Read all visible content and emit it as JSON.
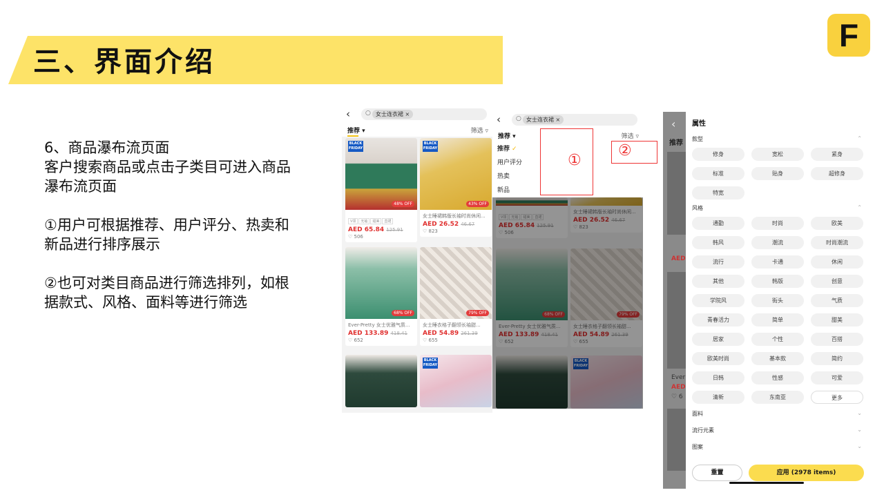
{
  "slide": {
    "title": "三、界面介绍",
    "logo_letter": "F",
    "desc": [
      [
        "6、商品瀑布流页面",
        "客户搜索商品或点击子类目可进入商品",
        "瀑布流页面"
      ],
      [
        "①用户可根据推荐、用户评分、热卖和",
        "新品进行排序展示"
      ],
      [
        "②也可对类目商品进行筛选排列，如根",
        "据款式、风格、面料等进行筛选"
      ]
    ]
  },
  "app": {
    "search_chip": "女士连衣裙 ×",
    "sort_label": "推荐 ▾",
    "filter_label": "筛选 ▿",
    "products": [
      {
        "badge": "BLACK FRIDAY",
        "off": "48% OFF",
        "tags": [
          "V领",
          "无袖",
          "甜美",
          "直裙"
        ],
        "price": "AED 65.84",
        "orig": "125.91",
        "likes": "♡ 506"
      },
      {
        "badge": "BLACK FRIDAY",
        "off": "43% OFF",
        "name": "女士睡裙韩版长袖时尚休闲...",
        "price": "AED 26.52",
        "orig": "46.67",
        "likes": "♡ 823"
      },
      {
        "off": "68% OFF",
        "name": "Ever-Pretty 女士优雅气质...",
        "price": "AED 133.89",
        "orig": "418.41",
        "likes": "♡ 652"
      },
      {
        "off": "79% OFF",
        "name": "女士睡衣格子翻领长袖甜...",
        "price": "AED 54.89",
        "orig": "261.39",
        "likes": "♡ 655"
      },
      {},
      {
        "badge": "BLACK FRIDAY"
      }
    ],
    "sort_menu": [
      "推荐",
      "用户评分",
      "热卖",
      "新品"
    ],
    "check": "✓",
    "markers": [
      "①",
      "②"
    ],
    "filter_panel": {
      "title": "属性",
      "sections": [
        {
          "name": "款型",
          "chevron": "⌃",
          "options": [
            "修身",
            "宽松",
            "紧身",
            "标准",
            "贴身",
            "超修身",
            "特宽"
          ]
        },
        {
          "name": "风格",
          "chevron": "⌃",
          "options": [
            "通勤",
            "时尚",
            "欧美",
            "韩风",
            "潮流",
            "时尚潮流",
            "流行",
            "卡通",
            "休闲",
            "其他",
            "韩版",
            "创意",
            "学院风",
            "街头",
            "气质",
            "青春活力",
            "简单",
            "甜美",
            "居家",
            "个性",
            "百搭",
            "欧美时尚",
            "基本款",
            "简约",
            "日韩",
            "性感",
            "可爱",
            "清新",
            "东南亚",
            "更多"
          ]
        }
      ],
      "collapsed": [
        "面料",
        "流行元素",
        "图案"
      ],
      "collapsed_chevron": "⌄",
      "reset_label": "重置",
      "apply_label": "应用 (2978 items)"
    },
    "bg_labels": {
      "recommend": "推荐",
      "aed": "AED",
      "ever": "Ever",
      "heart": "♡ 6"
    }
  },
  "colors": {
    "accent": "#fde368",
    "price": "#e0302f",
    "marker": "#ee3333"
  }
}
